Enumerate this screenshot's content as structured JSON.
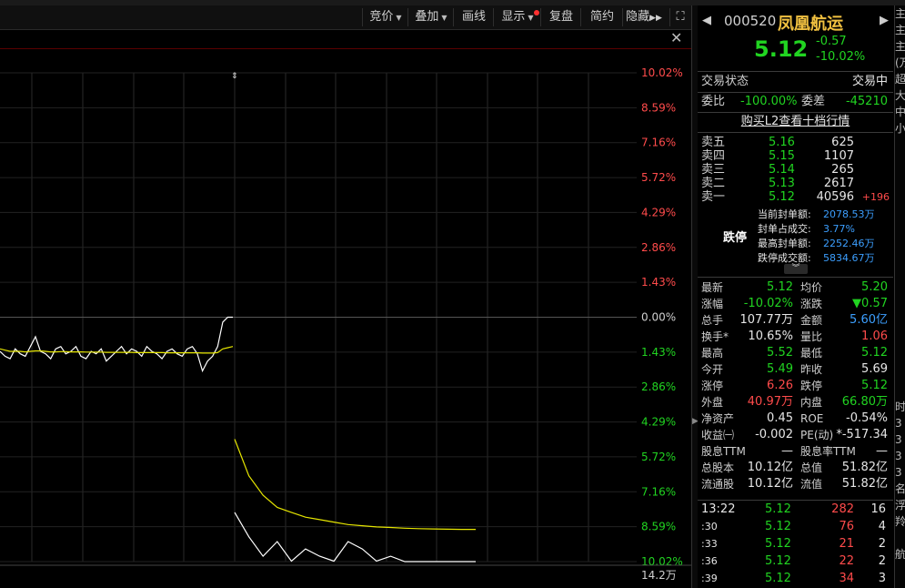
{
  "toolbar": {
    "items": [
      {
        "label": "竞价",
        "dropdown": true
      },
      {
        "label": "叠加",
        "dropdown": true
      },
      {
        "label": "画线",
        "dropdown": false
      },
      {
        "label": "显示",
        "dropdown": true,
        "dot": true
      },
      {
        "label": "复盘",
        "dropdown": false
      },
      {
        "label": "简约",
        "dropdown": false
      },
      {
        "label": "隐藏",
        "dropdown": false,
        "suffix": "▶▶"
      }
    ],
    "expand_icon": "expand-icon"
  },
  "close_icon": "close-icon",
  "chart": {
    "right_axis": [
      "10.02%",
      "8.59%",
      "7.16%",
      "5.72%",
      "4.29%",
      "2.86%",
      "1.43%",
      "0.00%",
      "1.43%",
      "2.86%",
      "4.29%",
      "5.72%",
      "7.16%",
      "8.59%",
      "10.02%"
    ],
    "volume_label": "14.2万",
    "colors": {
      "up": "#ff4b4b",
      "down": "#21d421",
      "zero": "#cfcfcf",
      "price_line": "#ffffff",
      "avg_line": "#e6e600"
    }
  },
  "chart_data": {
    "type": "line",
    "ylabel": "",
    "ylim": [
      -10.02,
      10.02
    ],
    "series": [
      {
        "values": [
          -1.4,
          -1.6,
          -1.7,
          -1.3,
          -1.5,
          -1.6,
          -1.2,
          -0.8,
          -1.4,
          -1.5,
          -1.7,
          -1.3,
          -1.2,
          -1.5,
          -1.4,
          -1.2,
          -1.6,
          -1.7,
          -1.4,
          -1.5,
          -1.3,
          -1.8,
          -1.6,
          -1.4,
          -1.2,
          -1.5,
          -1.3,
          -1.4,
          -1.6,
          -1.2,
          -1.4,
          -1.5,
          -1.7,
          -1.4,
          -1.3,
          -1.5,
          -1.6,
          -1.3,
          -1.2,
          -1.5,
          -2.2,
          -1.8,
          -1.6,
          -1.2,
          -0.2,
          0.0,
          0.0,
          -8.0,
          -9.0,
          -9.8,
          -9.2,
          -10.0,
          -9.5,
          -9.8,
          -10.0,
          -9.2,
          -9.5,
          -10.0,
          -9.8,
          -10.02,
          -10.02,
          -10.02,
          -10.02,
          -10.02,
          -10.02
        ]
      },
      {
        "values": [
          -1.3,
          -1.35,
          -1.4,
          -1.4,
          -1.4,
          -1.42,
          -1.4,
          -1.38,
          -1.38,
          -1.4,
          -1.42,
          -1.42,
          -1.41,
          -1.41,
          -1.42,
          -1.42,
          -1.42,
          -1.43,
          -1.43,
          -1.43,
          -1.43,
          -1.44,
          -1.44,
          -1.44,
          -1.44,
          -1.44,
          -1.44,
          -1.45,
          -1.45,
          -1.45,
          -1.45,
          -1.45,
          -1.45,
          -1.46,
          -1.46,
          -1.46,
          -1.46,
          -1.46,
          -1.46,
          -1.46,
          -1.47,
          -1.47,
          -1.47,
          -1.45,
          -1.3,
          -1.25,
          -1.2,
          -5.0,
          -6.5,
          -7.3,
          -7.8,
          -8.0,
          -8.2,
          -8.3,
          -8.4,
          -8.5,
          -8.55,
          -8.6,
          -8.62,
          -8.65,
          -8.67,
          -8.68,
          -8.69,
          -8.7,
          -8.7
        ]
      }
    ]
  },
  "quote": {
    "code": "000520",
    "name": "凤凰航运",
    "price": "5.12",
    "change": "-0.57",
    "change_pct": "-10.02%",
    "status_label": "交易状态",
    "status_value": "交易中",
    "weibi_label": "委比",
    "weibi_value": "-100.00%",
    "weicha_label": "委差",
    "weicha_value": "-45210",
    "l2_link": "购买L2查看十档行情"
  },
  "asks": [
    {
      "label": "卖五",
      "price": "5.16",
      "vol": "625",
      "delta": ""
    },
    {
      "label": "卖四",
      "price": "5.15",
      "vol": "1107",
      "delta": ""
    },
    {
      "label": "卖三",
      "price": "5.14",
      "vol": "265",
      "delta": ""
    },
    {
      "label": "卖二",
      "price": "5.13",
      "vol": "2617",
      "delta": ""
    },
    {
      "label": "卖一",
      "price": "5.12",
      "vol": "40596",
      "delta": "+196"
    }
  ],
  "limit_info": {
    "tag": "跌停",
    "rows": [
      {
        "label": "当前封单额:",
        "value": "2078.53万"
      },
      {
        "label": "封单占成交:",
        "value": "3.77%"
      },
      {
        "label": "最高封单额:",
        "value": "2252.46万"
      },
      {
        "label": "跌停成交额:",
        "value": "5834.67万"
      }
    ]
  },
  "stats": [
    {
      "l1": "最新",
      "v1": "5.12",
      "c1": "g",
      "l2": "均价",
      "v2": "5.20",
      "c2": "g"
    },
    {
      "l1": "涨幅",
      "v1": "-10.02%",
      "c1": "g",
      "l2": "涨跌",
      "v2": "▼0.57",
      "c2": "g"
    },
    {
      "l1": "总手",
      "v1": "107.77万",
      "c1": "w",
      "l2": "金额",
      "v2": "5.60亿",
      "c2": "b"
    },
    {
      "l1": "换手*",
      "v1": "10.65%",
      "c1": "w",
      "l2": "量比",
      "v2": "1.06",
      "c2": "r"
    },
    {
      "l1": "最高",
      "v1": "5.52",
      "c1": "g",
      "l2": "最低",
      "v2": "5.12",
      "c2": "g"
    },
    {
      "l1": "今开",
      "v1": "5.49",
      "c1": "g",
      "l2": "昨收",
      "v2": "5.69",
      "c2": "w"
    },
    {
      "l1": "涨停",
      "v1": "6.26",
      "c1": "r",
      "l2": "跌停",
      "v2": "5.12",
      "c2": "g"
    },
    {
      "l1": "外盘",
      "v1": "40.97万",
      "c1": "r",
      "l2": "内盘",
      "v2": "66.80万",
      "c2": "g"
    },
    {
      "l1": "净资产",
      "v1": "0.45",
      "c1": "w",
      "l2": "ROE",
      "v2": "-0.54%",
      "c2": "w"
    },
    {
      "l1": "收益㈠",
      "v1": "-0.002",
      "c1": "w",
      "l2": "PE(动)",
      "v2": "*-517.34",
      "c2": "w"
    },
    {
      "l1": "股息TTM",
      "v1": "—",
      "c1": "w",
      "l2": "股息率TTM",
      "v2": "—",
      "c2": "w"
    },
    {
      "l1": "总股本",
      "v1": "10.12亿",
      "c1": "w",
      "l2": "总值",
      "v2": "51.82亿",
      "c2": "w"
    },
    {
      "l1": "流通股",
      "v1": "10.12亿",
      "c1": "w",
      "l2": "流值",
      "v2": "51.82亿",
      "c2": "w"
    }
  ],
  "ticks": [
    {
      "time": "13:22",
      "price": "5.12",
      "vol": "282",
      "num": "16"
    },
    {
      "time": ":30",
      "price": "5.12",
      "vol": "76",
      "num": "4"
    },
    {
      "time": ":33",
      "price": "5.12",
      "vol": "21",
      "num": "2"
    },
    {
      "time": ":36",
      "price": "5.12",
      "vol": "22",
      "num": "2"
    },
    {
      "time": ":39",
      "price": "5.12",
      "vol": "34",
      "num": "3"
    }
  ],
  "far_chars": [
    "主",
    "主",
    "主",
    "(万",
    "超",
    "大",
    "中",
    "小",
    "",
    "",
    "",
    "",
    "",
    "",
    "",
    "",
    "",
    "",
    "",
    "",
    "",
    "",
    "",
    "",
    "时",
    "3",
    "3",
    "3",
    "3",
    "名",
    "浮",
    "羚",
    "",
    "航"
  ]
}
